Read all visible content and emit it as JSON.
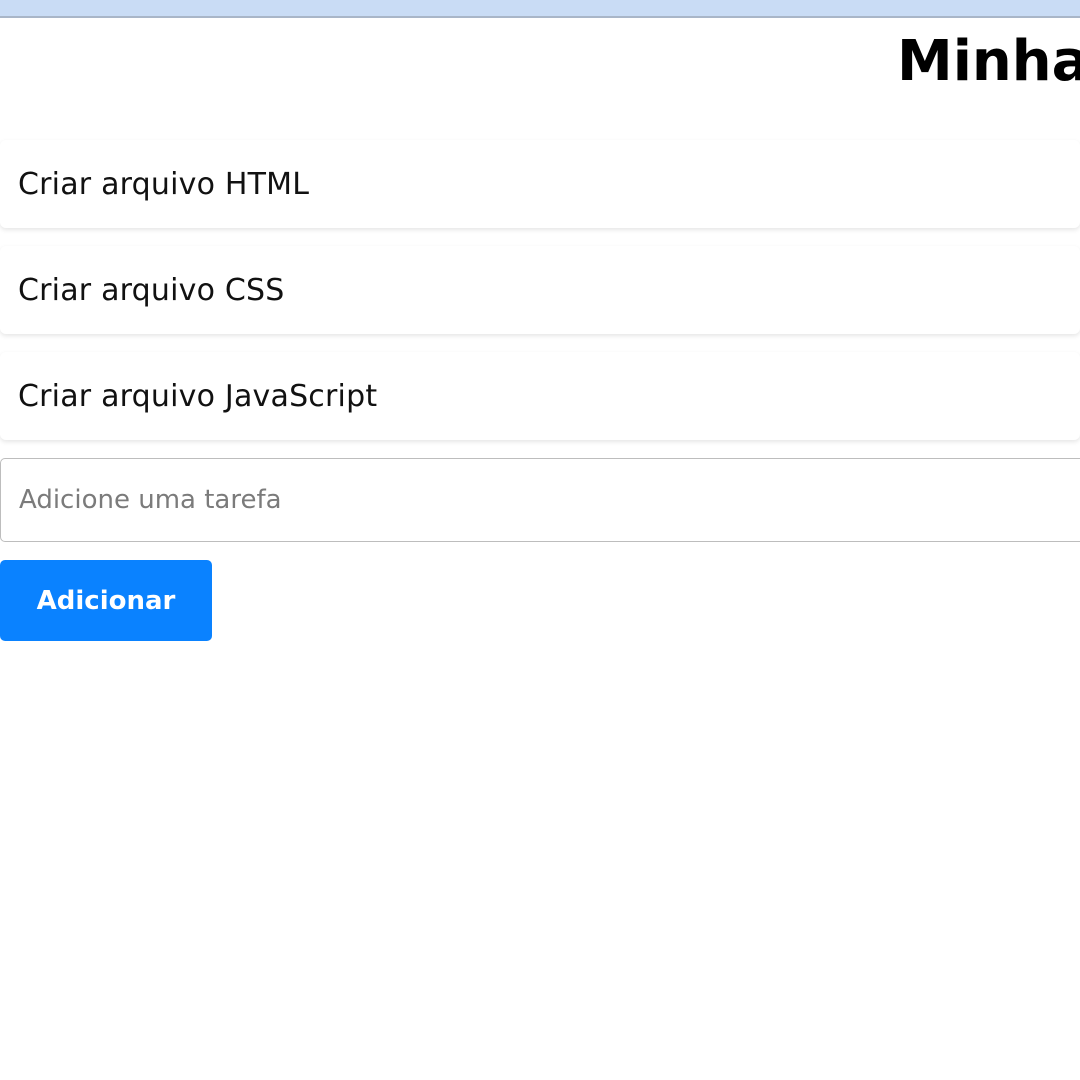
{
  "header": {
    "title": "Minha"
  },
  "tasks": [
    {
      "label": "Criar arquivo HTML"
    },
    {
      "label": "Criar arquivo CSS"
    },
    {
      "label": "Criar arquivo JavaScript"
    }
  ],
  "form": {
    "input_value": "",
    "input_placeholder": "Adicione uma tarefa",
    "add_label": "Adicionar"
  },
  "colors": {
    "accent": "#0a82ff",
    "top_strip": "#c9dcf5"
  }
}
